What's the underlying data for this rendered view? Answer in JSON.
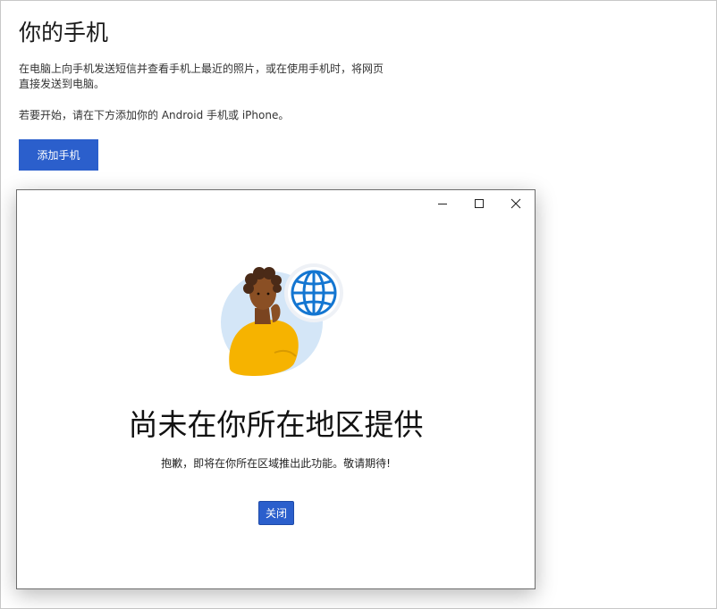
{
  "page": {
    "title": "你的手机",
    "description": "在电脑上向手机发送短信并查看手机上最近的照片，或在使用手机时，将网页直接发送到电脑。",
    "hint": "若要开始，请在下方添加你的 Android 手机或 iPhone。",
    "add_phone_label": "添加手机"
  },
  "dialog": {
    "title": "尚未在你所在地区提供",
    "message": "抱歉，即将在你所在区域推出此功能。敬请期待!",
    "close_label": "关闭",
    "window_controls": [
      "minimize-icon",
      "maximize-icon",
      "close-icon"
    ],
    "illustration_icon": "globe-icon"
  },
  "colors": {
    "accent": "#2b5fcc",
    "globe": "#1476d1",
    "shirt": "#f6b300",
    "skin": "#8a4f24",
    "hair": "#4a2a17"
  }
}
